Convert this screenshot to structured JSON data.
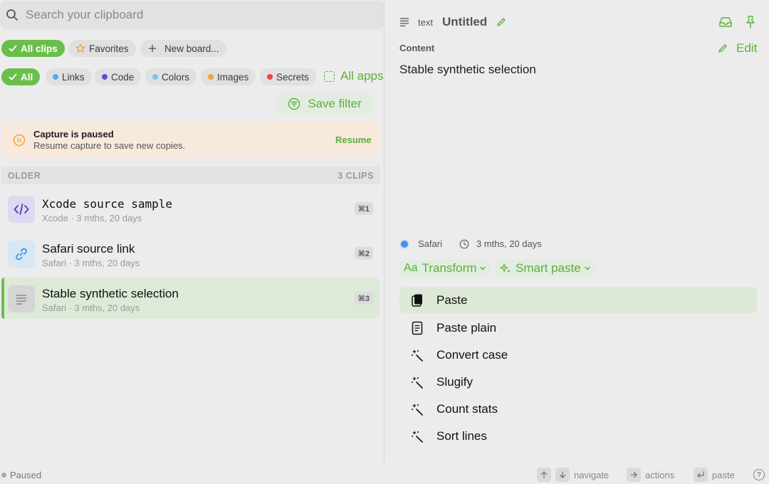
{
  "search": {
    "placeholder": "Search your clipboard"
  },
  "boards": [
    {
      "label": "All clips"
    },
    {
      "label": "Favorites"
    },
    {
      "label": "New board..."
    }
  ],
  "filters": [
    {
      "label": "All"
    },
    {
      "label": "Links",
      "color": "#5aa6e6"
    },
    {
      "label": "Code",
      "color": "#5a4fc8"
    },
    {
      "label": "Colors",
      "color": "#7cc2ee"
    },
    {
      "label": "Images",
      "color": "#f0a23c"
    },
    {
      "label": "Secrets",
      "color": "#e84a3c"
    }
  ],
  "all_apps": "All apps",
  "save_filter": "Save filter",
  "banner": {
    "title": "Capture is paused",
    "message": "Resume capture to save new copies.",
    "action": "Resume"
  },
  "section": {
    "title": "OLDER",
    "count": "3 CLIPS"
  },
  "clips": [
    {
      "title": "Xcode source sample",
      "subtitle": "Xcode · 3 mths, 20 days",
      "shortcut": "⌘1",
      "icon": "code-icon"
    },
    {
      "title": "Safari source link",
      "subtitle": "Safari · 3 mths, 20 days",
      "shortcut": "⌘2",
      "icon": "link-icon"
    },
    {
      "title": "Stable synthetic selection",
      "subtitle": "Safari · 3 mths, 20 days",
      "shortcut": "⌘3",
      "icon": "text-lines-icon"
    }
  ],
  "detail": {
    "type": "text",
    "title": "Untitled",
    "content_label": "Content",
    "edit_label": "Edit",
    "content": "Stable synthetic selection",
    "source_app": "Safari",
    "age": "3 mths, 20 days",
    "transform_label": "Transform",
    "transform_prefix": "Aa",
    "smart_paste_label": "Smart paste",
    "actions": [
      {
        "label": "Paste",
        "icon": "paste-icon"
      },
      {
        "label": "Paste plain",
        "icon": "document-icon"
      },
      {
        "label": "Convert case",
        "icon": "magic-wand-icon"
      },
      {
        "label": "Slugify",
        "icon": "magic-wand-icon"
      },
      {
        "label": "Count stats",
        "icon": "magic-wand-icon"
      },
      {
        "label": "Sort lines",
        "icon": "magic-wand-icon"
      }
    ]
  },
  "status": {
    "state": "Paused",
    "hint_navigate": "navigate",
    "hint_actions": "actions",
    "hint_paste": "paste",
    "help": "?"
  },
  "colors": {
    "accent": "#6abf4b",
    "banner_bg": "#f8e9dd",
    "pause_icon": "#f0a23c"
  }
}
